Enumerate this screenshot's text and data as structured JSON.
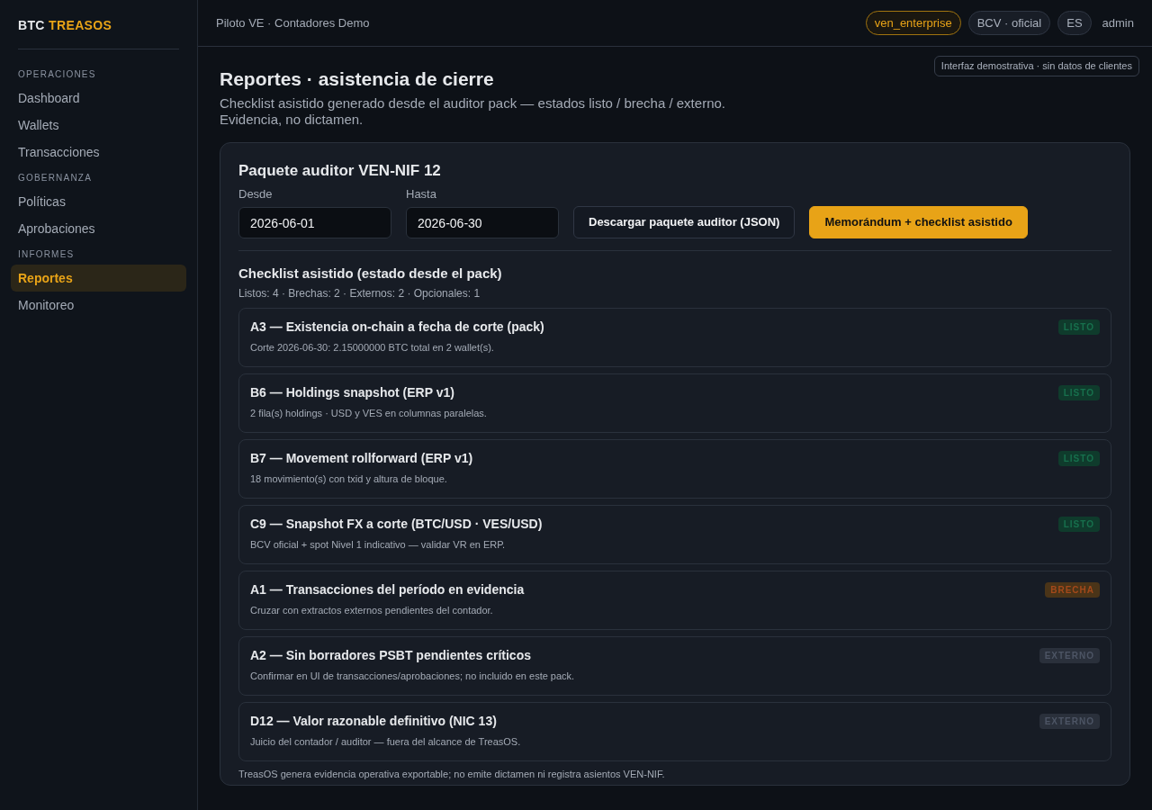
{
  "brand": {
    "first": "BTC",
    "second": "TREASOS"
  },
  "sidebar": {
    "sections": [
      {
        "heading": "OPERACIONES",
        "items": [
          {
            "label": "Dashboard",
            "selected": false
          },
          {
            "label": "Wallets",
            "selected": false
          },
          {
            "label": "Transacciones",
            "selected": false
          }
        ]
      },
      {
        "heading": "GOBERNANZA",
        "items": [
          {
            "label": "Políticas",
            "selected": false
          },
          {
            "label": "Aprobaciones",
            "selected": false
          }
        ]
      },
      {
        "heading": "INFORMES",
        "items": [
          {
            "label": "Reportes",
            "selected": true
          },
          {
            "label": "Monitoreo",
            "selected": false
          }
        ]
      }
    ]
  },
  "topbar": {
    "context": "Piloto VE · Contadores Demo",
    "chips": [
      {
        "label": "ven_enterprise",
        "kind": "accent"
      },
      {
        "label": "BCV · oficial",
        "kind": "plain"
      },
      {
        "label": "ES",
        "kind": "plain"
      }
    ],
    "user": "admin"
  },
  "notice": "Interfaz demostrativa · sin datos de clientes",
  "page": {
    "title": "Reportes · asistencia de cierre",
    "subtitle": "Checklist asistido generado desde el auditor pack — estados listo / brecha / externo.",
    "subtitle_2": "Evidencia, no dictamen."
  },
  "card": {
    "title": "Paquete auditor VEN-NIF 12",
    "from": {
      "label": "Desde",
      "value": "2026-06-01"
    },
    "to": {
      "label": "Hasta",
      "value": "2026-06-30"
    },
    "buttons": [
      {
        "label": "Descargar paquete auditor (JSON)",
        "kind": "secondary"
      },
      {
        "label": "Memorándum + checklist asistido",
        "kind": "primary"
      }
    ],
    "checklist_title": "Checklist asistido (estado desde el pack)",
    "summary": "Listos: 4 · Brechas: 2 · Externos: 2 · Opcionales: 1",
    "items": [
      {
        "title": "A3 — Existencia on-chain a fecha de corte (pack)",
        "detail": "Corte 2026-06-30: 2.15000000 BTC total en 2 wallet(s).",
        "status": {
          "label": "LISTO",
          "kind": "listo"
        }
      },
      {
        "title": "B6 — Holdings snapshot (ERP v1)",
        "detail": "2 fila(s) holdings · USD y VES en columnas paralelas.",
        "status": {
          "label": "LISTO",
          "kind": "listo"
        }
      },
      {
        "title": "B7 — Movement rollforward (ERP v1)",
        "detail": "18 movimiento(s) con txid y altura de bloque.",
        "status": {
          "label": "LISTO",
          "kind": "listo"
        }
      },
      {
        "title": "C9 — Snapshot FX a corte (BTC/USD · VES/USD)",
        "detail": "BCV oficial + spot Nivel 1 indicativo — validar VR en ERP.",
        "status": {
          "label": "LISTO",
          "kind": "listo"
        }
      },
      {
        "title": "A1 — Transacciones del período en evidencia",
        "detail": "Cruzar con extractos externos pendientes del contador.",
        "status": {
          "label": "BRECHA",
          "kind": "brecha"
        }
      },
      {
        "title": "A2 — Sin borradores PSBT pendientes críticos",
        "detail": "Confirmar en UI de transacciones/aprobaciones; no incluido en este pack.",
        "status": {
          "label": "EXTERNO",
          "kind": "externo"
        }
      },
      {
        "title": "D12 — Valor razonable definitivo (NIC 13)",
        "detail": "Juicio del contador / auditor — fuera del alcance de TreasOS.",
        "status": {
          "label": "EXTERNO",
          "kind": "externo"
        }
      }
    ],
    "footer": "TreasOS genera evidencia operativa exportable; no emite dictamen ni registra asientos VEN-NIF."
  }
}
